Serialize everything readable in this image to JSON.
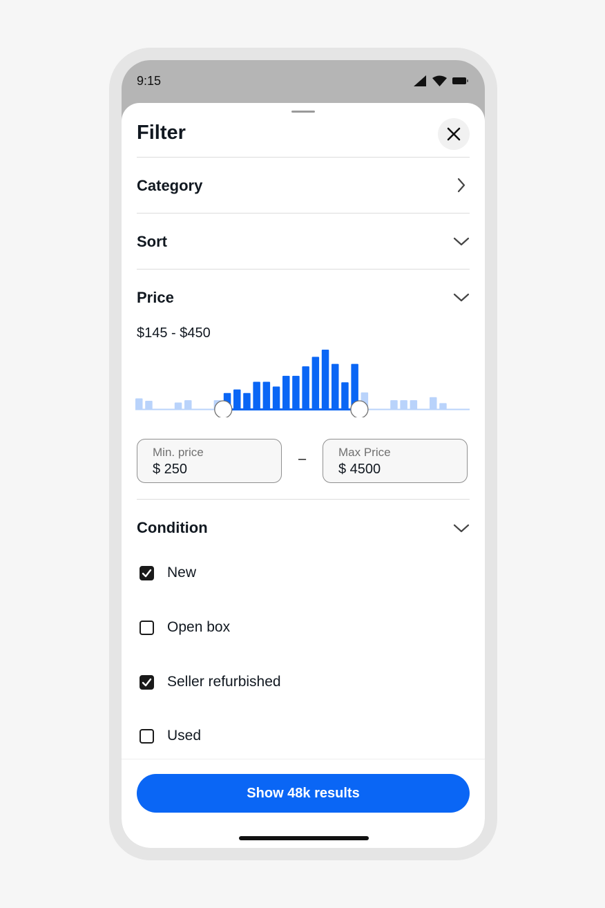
{
  "status_bar": {
    "time": "9:15"
  },
  "sheet": {
    "title": "Filter"
  },
  "sections": {
    "category": "Category",
    "sort": "Sort",
    "price": "Price",
    "condition": "Condition"
  },
  "price": {
    "range_label": "$145 - $450",
    "histogram": {
      "bars": [
        0.18,
        0.14,
        0,
        0,
        0.11,
        0.15,
        0,
        0,
        0.15,
        0.27,
        0.33,
        0.27,
        0.46,
        0.46,
        0.38,
        0.56,
        0.56,
        0.72,
        0.88,
        1.0,
        0.76,
        0.45,
        0.76,
        0.28,
        0,
        0,
        0.15,
        0.15,
        0.15,
        0,
        0.2,
        0.1
      ],
      "selected_range": [
        9,
        22
      ],
      "selected_color": "#0a66f5",
      "unselected_color": "#b9d3fb"
    },
    "min_field": {
      "label": "Min. price",
      "value": "$ 250"
    },
    "separator": "–",
    "max_field": {
      "label": "Max Price",
      "value": "$ 4500"
    }
  },
  "condition": {
    "options": [
      {
        "label": "New",
        "checked": true
      },
      {
        "label": "Open box",
        "checked": false
      },
      {
        "label": "Seller refurbished",
        "checked": true
      },
      {
        "label": "Used",
        "checked": false
      }
    ]
  },
  "cta": {
    "label": "Show 48k results",
    "color": "#0a66f5"
  },
  "icons": {
    "close": "close-icon",
    "category": "chevron-right-icon",
    "expand": "chevron-down-icon",
    "check": "checkmark-icon"
  }
}
